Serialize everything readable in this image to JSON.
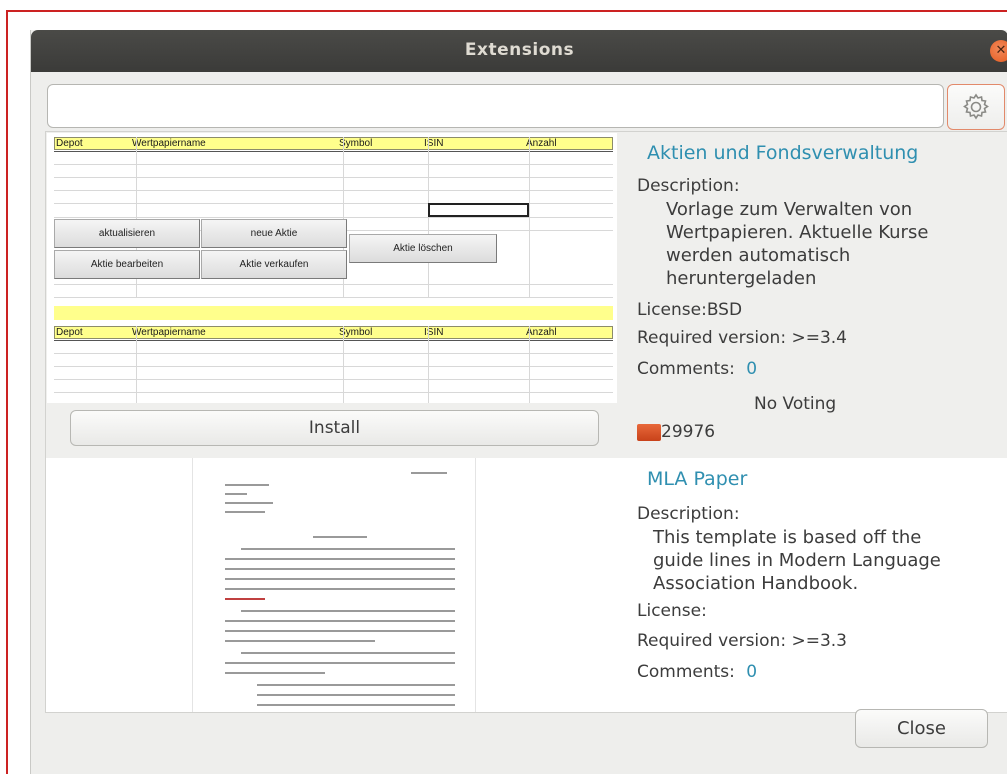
{
  "window": {
    "title": "Extensions",
    "close_glyph": "✕"
  },
  "search": {
    "value": "",
    "placeholder": ""
  },
  "settings": {
    "icon": "gear-icon"
  },
  "extensions": [
    {
      "name": "Aktien und Fondsverwaltung",
      "description_label": "Description:",
      "description": "Vorlage zum Verwalten von\nWertpapieren. Aktuelle Kurse\nwerden automatisch\nheruntergeladen",
      "license": "License:BSD",
      "required_version": "Required version: >=3.4",
      "comments_label": "Comments:",
      "comments_count": "0",
      "voting": "No Voting",
      "downloads": "29976",
      "install_label": "Install",
      "thumbnail": {
        "columns": [
          "Depot",
          "Wertpapiername",
          "Symbol",
          "ISIN",
          "Anzahl"
        ],
        "buttons": [
          "aktualisieren",
          "neue Aktie",
          "Aktie bearbeiten",
          "Aktie verkaufen",
          "Aktie löschen"
        ]
      }
    },
    {
      "name": "MLA Paper",
      "description_label": "Description:",
      "description": "This template is based off the\nguide lines in Modern Language\nAssociation Handbook.",
      "license": "License:",
      "required_version": "Required version: >=3.3",
      "comments_label": "Comments:",
      "comments_count": "0"
    }
  ],
  "footer": {
    "close_label": "Close"
  },
  "colors": {
    "link": "#2f8fb0",
    "titlebar": "#3c3c3a",
    "sheet_header": "#ffff8c",
    "frame": "#cc2222"
  }
}
